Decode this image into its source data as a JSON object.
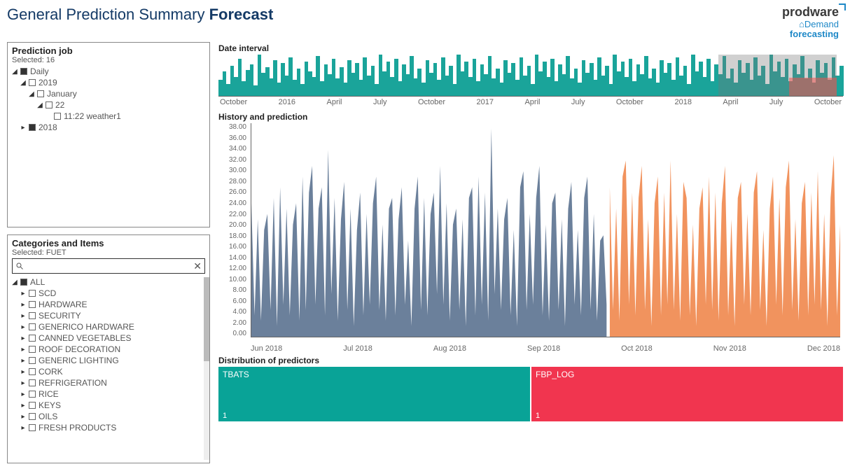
{
  "header": {
    "title_light": "General Prediction Summary ",
    "title_bold": "Forecast",
    "brand_top": "prodware",
    "brand_l1": "Demand",
    "brand_l2": "forecasting"
  },
  "panels": {
    "job": {
      "title": "Prediction job",
      "selected_label": "Selected: 16",
      "tree": [
        {
          "level": 1,
          "caret": "down",
          "checked": true,
          "label": "Daily"
        },
        {
          "level": 2,
          "caret": "down",
          "checked": false,
          "label": "2019"
        },
        {
          "level": 3,
          "caret": "down",
          "checked": false,
          "label": "January"
        },
        {
          "level": 4,
          "caret": "down",
          "checked": false,
          "label": "22"
        },
        {
          "level": 5,
          "caret": "",
          "checked": false,
          "label": "11:22 weather1"
        },
        {
          "level": 2,
          "caret": "right",
          "checked": true,
          "label": "2018"
        }
      ]
    },
    "cats": {
      "title": "Categories and Items",
      "selected_label": "Selected: FUET",
      "search_placeholder": "",
      "items": [
        {
          "caret": "down",
          "checked": true,
          "label": "ALL"
        },
        {
          "caret": "right",
          "checked": false,
          "label": "SCD"
        },
        {
          "caret": "right",
          "checked": false,
          "label": "HARDWARE"
        },
        {
          "caret": "right",
          "checked": false,
          "label": "SECURITY"
        },
        {
          "caret": "right",
          "checked": false,
          "label": "GENERICO HARDWARE"
        },
        {
          "caret": "right",
          "checked": false,
          "label": "CANNED VEGETABLES"
        },
        {
          "caret": "right",
          "checked": false,
          "label": "ROOF DECORATION"
        },
        {
          "caret": "right",
          "checked": false,
          "label": "GENERIC LIGHTING"
        },
        {
          "caret": "right",
          "checked": false,
          "label": "CORK"
        },
        {
          "caret": "right",
          "checked": false,
          "label": "REFRIGERATION"
        },
        {
          "caret": "right",
          "checked": false,
          "label": "RICE"
        },
        {
          "caret": "right",
          "checked": false,
          "label": "KEYS"
        },
        {
          "caret": "right",
          "checked": false,
          "label": "OILS"
        },
        {
          "caret": "right",
          "checked": false,
          "label": "FRESH PRODUCTS"
        }
      ]
    }
  },
  "sections": {
    "interval_label": "Date interval",
    "history_label": "History and prediction",
    "dist_label": "Distribution of predictors"
  },
  "predictors": {
    "a": {
      "name": "TBATS",
      "count": "1"
    },
    "b": {
      "name": "FBP_LOG",
      "count": "1"
    }
  },
  "chart_data": {
    "mini": {
      "type": "bar",
      "ticks": [
        "October",
        "2016",
        "April",
        "July",
        "October",
        "2017",
        "April",
        "July",
        "October",
        "2018",
        "April",
        "July",
        "October"
      ],
      "brush": {
        "start_pct": 80,
        "end_pct": 99
      },
      "values": [
        12,
        18,
        9,
        22,
        14,
        27,
        11,
        19,
        23,
        8,
        30,
        17,
        21,
        13,
        26,
        10,
        24,
        15,
        28,
        12,
        20,
        9,
        25,
        18,
        14,
        29,
        11,
        23,
        16,
        27,
        13,
        21,
        10,
        26,
        17,
        24,
        12,
        28,
        15,
        22,
        9,
        30,
        18,
        25,
        14,
        27,
        11,
        23,
        16,
        29,
        13,
        20,
        10,
        26,
        17,
        24,
        12,
        28,
        15,
        22,
        9,
        30,
        18,
        25,
        14,
        27,
        11,
        23,
        16,
        29,
        13,
        20,
        10,
        26,
        17,
        24,
        12,
        28,
        15,
        22,
        9,
        30,
        18,
        25,
        14,
        27,
        11,
        23,
        16,
        29,
        13,
        20,
        10,
        26,
        17,
        24,
        12,
        28,
        15,
        22,
        9,
        30,
        18,
        25,
        14,
        27,
        11,
        23,
        16,
        29,
        13,
        20,
        10,
        26,
        17,
        24,
        12,
        28,
        15,
        22,
        9,
        30,
        18,
        25,
        14,
        27,
        11,
        23,
        16,
        29,
        13,
        20,
        10,
        26,
        17,
        24,
        12,
        28,
        15,
        22,
        9,
        30,
        18,
        25,
        14,
        27,
        11,
        23,
        16,
        29,
        13,
        20,
        10,
        26,
        17,
        24,
        12,
        28,
        15,
        22
      ]
    },
    "big": {
      "type": "area",
      "ylim": [
        0,
        40
      ],
      "yticks": [
        "38.00",
        "36.00",
        "34.00",
        "32.00",
        "30.00",
        "28.00",
        "26.00",
        "24.00",
        "22.00",
        "20.00",
        "18.00",
        "16.00",
        "14.00",
        "12.00",
        "10.00",
        "8.00",
        "6.00",
        "4.00",
        "2.00",
        "0.00"
      ],
      "xticks": [
        "Jun 2018",
        "Jul 2018",
        "Aug 2018",
        "Sep 2018",
        "Oct 2018",
        "Nov 2018",
        "Dec 2018"
      ],
      "split_index": 112,
      "series": [
        {
          "name": "history",
          "color": "#5e7593",
          "values": [
            25,
            4,
            22,
            3,
            20,
            23,
            5,
            26,
            2,
            28,
            6,
            24,
            4,
            21,
            25,
            3,
            30,
            5,
            27,
            32,
            6,
            24,
            28,
            4,
            35,
            8,
            26,
            3,
            22,
            29,
            5,
            24,
            2,
            20,
            27,
            4,
            23,
            6,
            25,
            30,
            5,
            21,
            3,
            24,
            26,
            4,
            22,
            28,
            6,
            18,
            2,
            24,
            30,
            5,
            26,
            4,
            23,
            27,
            8,
            32,
            6,
            25,
            3,
            21,
            24,
            5,
            22,
            2,
            26,
            28,
            4,
            30,
            6,
            27,
            3,
            39,
            8,
            24,
            5,
            22,
            26,
            4,
            20,
            2,
            28,
            31,
            5,
            23,
            6,
            26,
            32,
            4,
            21,
            3,
            25,
            27,
            5,
            22,
            2,
            24,
            29,
            6,
            20,
            4,
            26,
            30,
            5,
            23,
            3,
            18,
            19,
            6
          ]
        },
        {
          "name": "forecast",
          "color": "#f08a50",
          "values": [
            28,
            5,
            24,
            3,
            30,
            33,
            6,
            27,
            4,
            26,
            32,
            5,
            22,
            2,
            25,
            30,
            4,
            27,
            6,
            33,
            5,
            23,
            3,
            29,
            26,
            4,
            21,
            2,
            24,
            28,
            6,
            30,
            5,
            27,
            3,
            25,
            32,
            4,
            22,
            2,
            26,
            29,
            6,
            23,
            4,
            27,
            31,
            5,
            20,
            2,
            24,
            30,
            6,
            26,
            4,
            28,
            33,
            5,
            22,
            3,
            25,
            29,
            4,
            27,
            6,
            31,
            5,
            23,
            2,
            26,
            34,
            4,
            21
          ]
        }
      ]
    }
  }
}
